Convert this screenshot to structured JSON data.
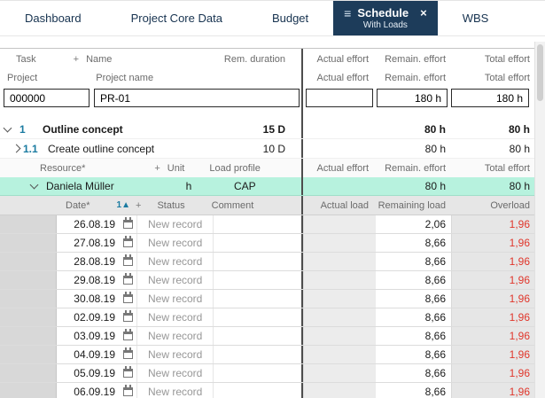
{
  "tabs": {
    "items": [
      {
        "label": "Dashboard"
      },
      {
        "label": "Project Core Data"
      },
      {
        "label": "Budget"
      },
      {
        "label": "Schedule",
        "subtitle": "With Loads",
        "active": true
      },
      {
        "label": "WBS"
      }
    ]
  },
  "icons": {
    "hamburger": "≡",
    "close": "×",
    "plus": "+",
    "sort_value": "1",
    "sort_arrow": "▲"
  },
  "columns": {
    "task": "Task",
    "name": "Name",
    "rem_duration": "Rem. duration",
    "actual_effort": "Actual effort",
    "remain_effort": "Remain. effort",
    "total_effort": "Total effort",
    "project": "Project",
    "project_name": "Project name",
    "resource": "Resource*",
    "unit": "Unit",
    "load_profile": "Load profile",
    "date": "Date*",
    "status": "Status",
    "comment": "Comment",
    "actual_load": "Actual load",
    "remaining_load": "Remaining load",
    "overload": "Overload"
  },
  "project_row": {
    "id": "000000",
    "name": "PR-01",
    "actual_effort": "",
    "remain_effort": "180 h",
    "total_effort": "180 h"
  },
  "tasks": [
    {
      "num": "1",
      "name": "Outline concept",
      "duration": "15 D",
      "remain_effort": "80 h",
      "total_effort": "80 h"
    },
    {
      "num": "1.1",
      "name": "Create outline concept",
      "duration": "10 D",
      "remain_effort": "80 h",
      "total_effort": "80 h"
    }
  ],
  "resource_row": {
    "name": "Daniela Müller",
    "unit": "h",
    "load_profile": "CAP",
    "remain_effort": "80 h",
    "total_effort": "80 h"
  },
  "load_rows": [
    {
      "date": "26.08.19",
      "status": "New record",
      "actual_load": "",
      "remaining": "2,06",
      "overload": "1,96"
    },
    {
      "date": "27.08.19",
      "status": "New record",
      "actual_load": "",
      "remaining": "8,66",
      "overload": "1,96"
    },
    {
      "date": "28.08.19",
      "status": "New record",
      "actual_load": "",
      "remaining": "8,66",
      "overload": "1,96"
    },
    {
      "date": "29.08.19",
      "status": "New record",
      "actual_load": "",
      "remaining": "8,66",
      "overload": "1,96"
    },
    {
      "date": "30.08.19",
      "status": "New record",
      "actual_load": "",
      "remaining": "8,66",
      "overload": "1,96"
    },
    {
      "date": "02.09.19",
      "status": "New record",
      "actual_load": "",
      "remaining": "8,66",
      "overload": "1,96"
    },
    {
      "date": "03.09.19",
      "status": "New record",
      "actual_load": "",
      "remaining": "8,66",
      "overload": "1,96"
    },
    {
      "date": "04.09.19",
      "status": "New record",
      "actual_load": "",
      "remaining": "8,66",
      "overload": "1,96"
    },
    {
      "date": "05.09.19",
      "status": "New record",
      "actual_load": "",
      "remaining": "8,66",
      "overload": "1,96"
    },
    {
      "date": "06.09.19",
      "status": "New record",
      "actual_load": "",
      "remaining": "8,66",
      "overload": "1,96"
    }
  ],
  "colors": {
    "active_tab": "#1d3c5a",
    "resource_highlight": "#b7f2de",
    "overload_text": "#e0362b",
    "hierarchy_number": "#1b7ba1"
  }
}
